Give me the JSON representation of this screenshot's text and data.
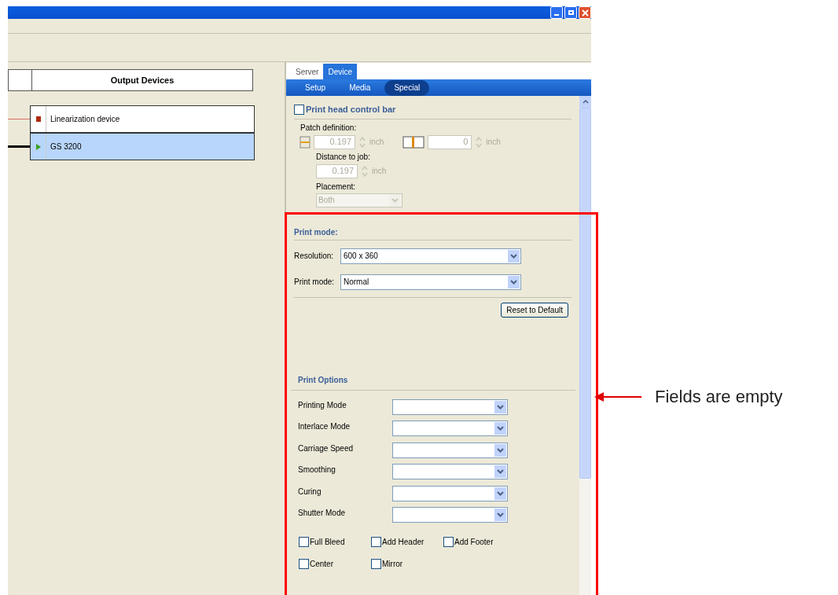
{
  "output_devices": {
    "header": "Output Devices",
    "items": [
      {
        "name": "Linearization device",
        "kind": "stop",
        "selected": false
      },
      {
        "name": "GS 3200",
        "kind": "play",
        "selected": true
      }
    ]
  },
  "tabs": [
    {
      "label": "Server",
      "selected": false
    },
    {
      "label": "Device",
      "selected": true
    }
  ],
  "subtabs": [
    {
      "label": "Setup",
      "selected": false
    },
    {
      "label": "Media",
      "selected": false
    },
    {
      "label": "Special",
      "selected": true
    }
  ],
  "control_bar": {
    "label": "Print head control bar",
    "checked": false,
    "disabled": true,
    "patch_label": "Patch definition:",
    "width_value": "0.197",
    "width_unit": "inch",
    "offset_value": "0",
    "offset_unit": "inch",
    "distance_label": "Distance to job:",
    "distance_value": "0.197",
    "distance_unit": "inch",
    "placement_label": "Placement:",
    "placement_value": "Both"
  },
  "print_mode": {
    "title": "Print mode:",
    "fields": [
      {
        "label": "Resolution:",
        "value": "600 x 360"
      },
      {
        "label": "Print mode:",
        "value": "Normal"
      }
    ],
    "reset_button": "Reset to Default"
  },
  "print_options": {
    "title": "Print Options",
    "fields": [
      {
        "label": "Printing Mode"
      },
      {
        "label": "Interlace Mode"
      },
      {
        "label": "Carriage Speed"
      },
      {
        "label": "Smoothing"
      },
      {
        "label": "Curing"
      },
      {
        "label": "Shutter Mode"
      }
    ],
    "checkboxes": [
      {
        "label": "Full Bleed",
        "checked": false
      },
      {
        "label": "Add Header",
        "checked": false
      },
      {
        "label": "Add Footer",
        "checked": false
      },
      {
        "label": "Center",
        "checked": false
      },
      {
        "label": "Mirror",
        "checked": false
      }
    ]
  },
  "annotation": {
    "text": "Fields are empty"
  }
}
